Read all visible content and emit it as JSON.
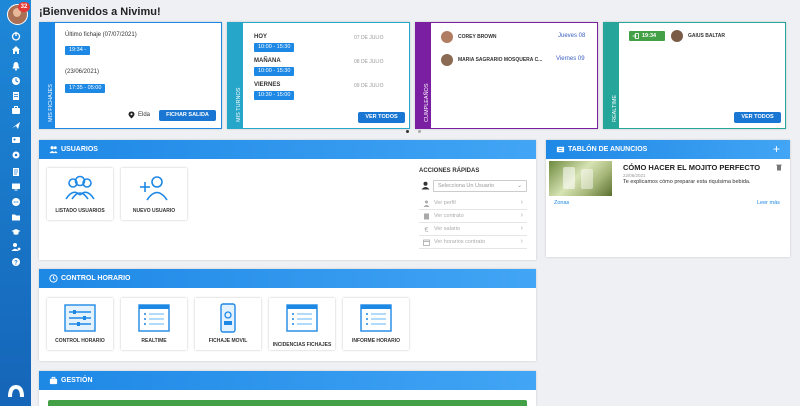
{
  "sidebar": {
    "badge_count": "32",
    "icons": [
      "power-icon",
      "home-icon",
      "bell-icon",
      "clock-icon",
      "briefcase-icon",
      "plane-icon",
      "id-card-icon",
      "gear-icon",
      "document-icon",
      "monitor-icon",
      "chat-icon",
      "folder-icon",
      "graduation-icon",
      "users-cog-icon",
      "help-icon"
    ]
  },
  "welcome": "¡Bienvenidos a Nivimu!",
  "fichajes": {
    "strip_label": "MIS FICHAJES",
    "last_label": "Último fichaje (07/07/2021)",
    "last_time": "19:34 -",
    "prev_date": "(23/06/2021)",
    "prev_time": "17:35 - 05:00",
    "location": "Elda",
    "button": "FICHAR SALIDA"
  },
  "turnos": {
    "strip_label": "MIS TURNOS",
    "rows": [
      {
        "day": "HOY",
        "date": "07 DE JULIO",
        "time": "10:00 - 15:30"
      },
      {
        "day": "MAÑANA",
        "date": "08 DE JULIO",
        "time": "10:00 - 15:30"
      },
      {
        "day": "VIERNES",
        "date": "09 DE JULIO",
        "time": "10:30 - 15:00"
      }
    ],
    "button": "VER TODOS"
  },
  "cumpleanos": {
    "strip_label": "CUMPLEAÑOS",
    "people": [
      {
        "name": "COREY BROWN",
        "day": "Jueves 08"
      },
      {
        "name": "MARIA SAGRARIO MOSQUERA C...",
        "day": "Viernes 09"
      }
    ]
  },
  "realtime": {
    "strip_label": "REALTIME",
    "time": "19:34",
    "person": "GAIUS BALTAR",
    "button": "VER TODOS"
  },
  "usuarios": {
    "title": "USUARIOS",
    "tiles": [
      {
        "label": "LISTADO USUARIOS"
      },
      {
        "label": "NUEVO USUARIO"
      }
    ],
    "quick_actions": {
      "title": "ACCIONES RÁPIDAS",
      "select_placeholder": "Selecciona Un Usuario",
      "items": [
        "Ver perfil",
        "Ver contrato",
        "Ver salario",
        "Ver horarios contrato"
      ]
    }
  },
  "control": {
    "title": "CONTROL HORARIO",
    "tiles": [
      {
        "label": "CONTROL HORARIO"
      },
      {
        "label": "REALTIME"
      },
      {
        "label": "FICHAJE MOVIL"
      },
      {
        "label": "INCIDENCIAS FICHAJES"
      },
      {
        "label": "INFORME HORARIO"
      }
    ]
  },
  "gestion": {
    "title": "GESTIÓN"
  },
  "anuncios": {
    "title": "TABLÓN DE ANUNCIOS",
    "add": "+",
    "post_title": "CÓMO HACER EL MOJITO PERFECTO",
    "post_date": "22/06/2021",
    "post_text": "Te explicamos cómo preparar esta riquísima bebida.",
    "zones_link": "Zonas",
    "more_link": "Leer más"
  },
  "colors": {
    "primary": "#1e88e5",
    "purple": "#7b1fa2",
    "teal": "#26a69a",
    "green": "#43a047"
  }
}
